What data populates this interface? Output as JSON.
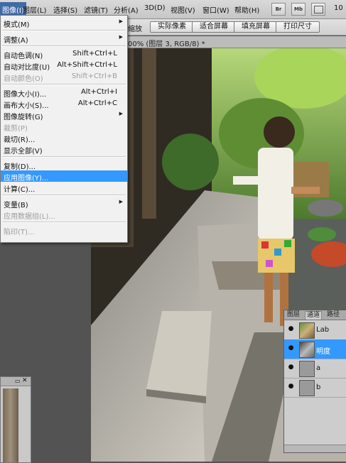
{
  "menubar": {
    "items": [
      "图像(I)",
      "图层(L)",
      "选择(S)",
      "滤镜(T)",
      "分析(A)",
      "3D(D)",
      "视图(V)",
      "窗口(W)",
      "帮助(H)"
    ],
    "app_buttons": [
      "Br",
      "Mb"
    ],
    "zoom_fragment": "10"
  },
  "optbar": {
    "partial_label": "缩放",
    "buttons": [
      "实际像素",
      "适合屏幕",
      "填充屏幕",
      "打印尺寸"
    ]
  },
  "doc_tab": {
    "title": "00% (图层 3, RGB/8) *"
  },
  "image_menu": {
    "items": [
      {
        "label": "模式(M)",
        "shortcut": "",
        "submenu": true,
        "enabled": true,
        "highlighted": false
      },
      {
        "sep": true
      },
      {
        "label": "调整(A)",
        "shortcut": "",
        "submenu": true,
        "enabled": true,
        "highlighted": false
      },
      {
        "sep": true
      },
      {
        "label": "自动色调(N)",
        "shortcut": "Shift+Ctrl+L",
        "submenu": false,
        "enabled": true,
        "highlighted": false
      },
      {
        "label": "自动对比度(U)",
        "shortcut": "Alt+Shift+Ctrl+L",
        "submenu": false,
        "enabled": true,
        "highlighted": false
      },
      {
        "label": "自动颜色(O)",
        "shortcut": "Shift+Ctrl+B",
        "submenu": false,
        "enabled": false,
        "highlighted": false
      },
      {
        "sep": true
      },
      {
        "label": "图像大小(I)...",
        "shortcut": "Alt+Ctrl+I",
        "submenu": false,
        "enabled": true,
        "highlighted": false
      },
      {
        "label": "画布大小(S)...",
        "shortcut": "Alt+Ctrl+C",
        "submenu": false,
        "enabled": true,
        "highlighted": false
      },
      {
        "label": "图像旋转(G)",
        "shortcut": "",
        "submenu": true,
        "enabled": true,
        "highlighted": false
      },
      {
        "label": "裁剪(P)",
        "shortcut": "",
        "submenu": false,
        "enabled": false,
        "highlighted": false
      },
      {
        "label": "裁切(R)...",
        "shortcut": "",
        "submenu": false,
        "enabled": true,
        "highlighted": false
      },
      {
        "label": "显示全部(V)",
        "shortcut": "",
        "submenu": false,
        "enabled": true,
        "highlighted": false
      },
      {
        "sep": true
      },
      {
        "label": "复制(D)...",
        "shortcut": "",
        "submenu": false,
        "enabled": true,
        "highlighted": false
      },
      {
        "label": "应用图像(Y)...",
        "shortcut": "",
        "submenu": false,
        "enabled": true,
        "highlighted": true
      },
      {
        "label": "计算(C)...",
        "shortcut": "",
        "submenu": false,
        "enabled": true,
        "highlighted": false
      },
      {
        "sep": true
      },
      {
        "label": "变量(B)",
        "shortcut": "",
        "submenu": true,
        "enabled": true,
        "highlighted": false
      },
      {
        "label": "应用数据组(L)...",
        "shortcut": "",
        "submenu": false,
        "enabled": false,
        "highlighted": false
      },
      {
        "sep": true
      },
      {
        "label": "陷印(T)...",
        "shortcut": "",
        "submenu": false,
        "enabled": false,
        "highlighted": false
      }
    ]
  },
  "channels_panel": {
    "tabs": [
      "图层",
      "通道",
      "路径"
    ],
    "active_tab": "通道",
    "channels": [
      {
        "name": "Lab",
        "selected": false,
        "thumb": "color"
      },
      {
        "name": "明度",
        "selected": true,
        "thumb": "gray"
      },
      {
        "name": "a",
        "selected": false,
        "thumb": "flat"
      },
      {
        "name": "b",
        "selected": false,
        "thumb": "flat"
      }
    ]
  },
  "colors": {
    "menu_highlight": "#3399ff",
    "menubar_active": "#3f6ba6",
    "channel_selected": "#3399ff"
  },
  "icons": [
    "eye-icon",
    "submenu-arrow-icon",
    "close-icon",
    "collapse-icon"
  ]
}
